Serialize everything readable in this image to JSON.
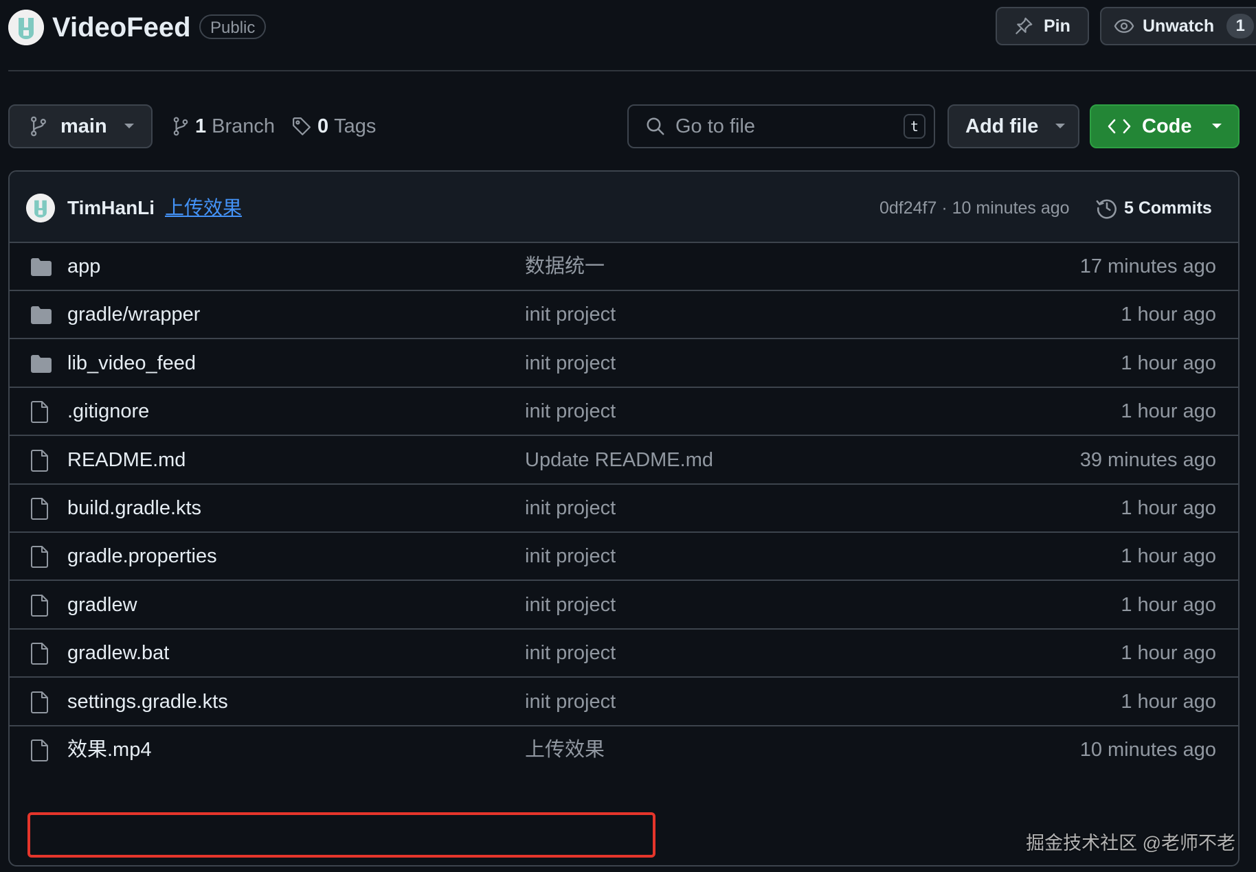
{
  "repo": {
    "name": "VideoFeed",
    "visibility": "Public"
  },
  "header_actions": {
    "pin_label": "Pin",
    "unwatch_label": "Unwatch",
    "watch_count": "1"
  },
  "toolbar": {
    "branch_name": "main",
    "branch_count": "1",
    "branch_label": "Branch",
    "tag_count": "0",
    "tag_label": "Tags",
    "search_placeholder": "Go to file",
    "search_shortcut": "t",
    "add_file_label": "Add file",
    "code_label": "Code"
  },
  "latest_commit": {
    "author": "TimHanLi",
    "message": "上传效果",
    "meta": "0df24f7 · 10 minutes ago",
    "commits_label": "5 Commits"
  },
  "files": [
    {
      "type": "folder",
      "name": "app",
      "message": "数据统一",
      "date": "17 minutes ago"
    },
    {
      "type": "folder",
      "name": "gradle/wrapper",
      "message": "init project",
      "date": "1 hour ago"
    },
    {
      "type": "folder",
      "name": "lib_video_feed",
      "message": "init project",
      "date": "1 hour ago"
    },
    {
      "type": "file",
      "name": ".gitignore",
      "message": "init project",
      "date": "1 hour ago"
    },
    {
      "type": "file",
      "name": "README.md",
      "message": "Update README.md",
      "date": "39 minutes ago"
    },
    {
      "type": "file",
      "name": "build.gradle.kts",
      "message": "init project",
      "date": "1 hour ago"
    },
    {
      "type": "file",
      "name": "gradle.properties",
      "message": "init project",
      "date": "1 hour ago"
    },
    {
      "type": "file",
      "name": "gradlew",
      "message": "init project",
      "date": "1 hour ago"
    },
    {
      "type": "file",
      "name": "gradlew.bat",
      "message": "init project",
      "date": "1 hour ago"
    },
    {
      "type": "file",
      "name": "settings.gradle.kts",
      "message": "init project",
      "date": "1 hour ago"
    },
    {
      "type": "file",
      "name": "效果.mp4",
      "message": "上传效果",
      "date": "10 minutes ago"
    }
  ],
  "watermark": "掘金技术社区 @老师不老",
  "colors": {
    "background": "#0d1117",
    "border": "#3d444d",
    "accent_green": "#238636",
    "link_blue": "#4493f8",
    "highlight_red": "#e5352b"
  }
}
